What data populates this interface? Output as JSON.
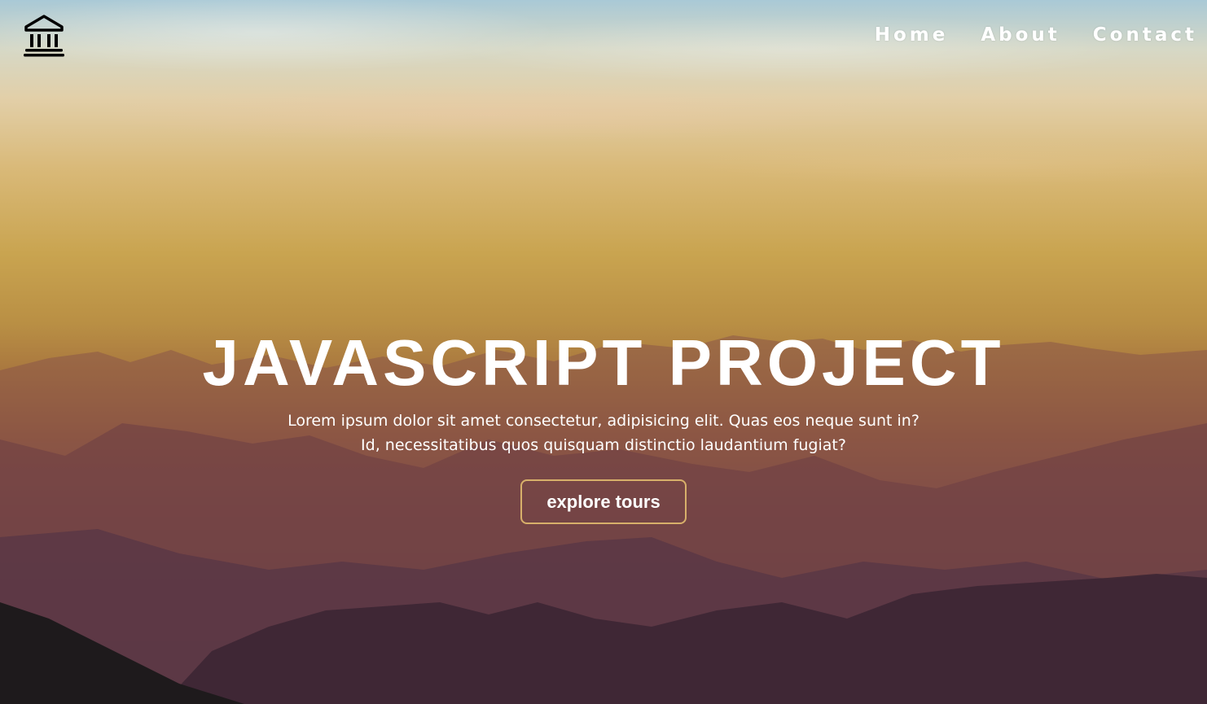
{
  "nav": {
    "items": [
      {
        "label": "Home"
      },
      {
        "label": "About"
      },
      {
        "label": "Contact"
      }
    ]
  },
  "banner": {
    "title": "JAVASCRIPT PROJECT",
    "text": "Lorem ipsum dolor sit amet consectetur, adipisicing elit. Quas eos neque sunt in? Id, necessitatibus quos quisquam distinctio laudantium fugiat?",
    "cta_label": "explore tours"
  },
  "logo_icon": "bank-building-icon",
  "colors": {
    "text": "#ffffff",
    "cta_border": "#d8b06a",
    "logo": "#000000"
  }
}
